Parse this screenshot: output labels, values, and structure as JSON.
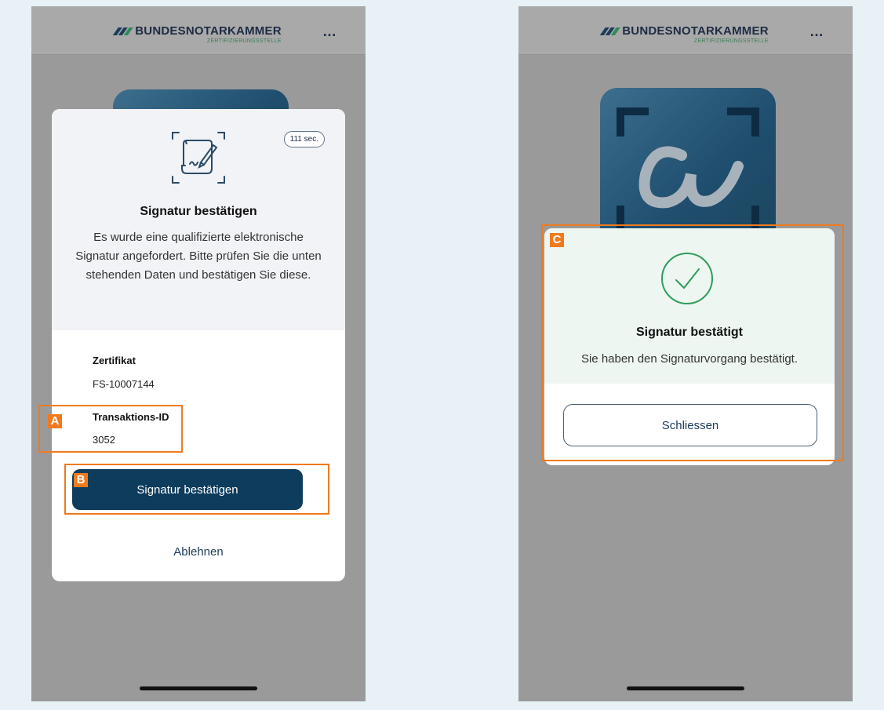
{
  "header": {
    "brand": "BUNDESNOTARKAMMER",
    "sub_brand": "ZERTIFIZIERUNGSSTELLE",
    "menu_icon": "more-dots-icon",
    "menu_glyph": "…"
  },
  "confirm_dialog": {
    "timer": "111 sec.",
    "icon": "document-sign-icon",
    "title": "Signatur bestätigen",
    "text": "Es wurde eine qualifizierte elektronische Signatur angefordert. Bitte prüfen Sie die unten stehenden Daten und bestätigen Sie diese.",
    "certificate_label": "Zertifikat",
    "certificate_value": "FS-10007144",
    "transaction_label": "Transaktions-ID",
    "transaction_value": "3052",
    "confirm_button": "Signatur bestätigen",
    "reject_button": "Ablehnen"
  },
  "success_dialog": {
    "icon": "check-circle-icon",
    "title": "Signatur bestätigt",
    "text": "Sie haben den Signaturvorgang bestätigt.",
    "close_button": "Schliessen"
  },
  "annotations": {
    "a": "A",
    "b": "B",
    "c": "C"
  },
  "colors": {
    "primary": "#0e3c5c",
    "highlight": "#f07a1d",
    "success": "#2e9e5b",
    "overlay": "#9a9a9a"
  }
}
